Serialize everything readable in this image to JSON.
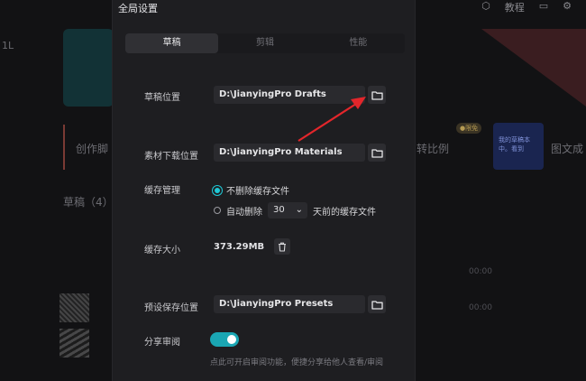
{
  "background": {
    "sidebar_glyph": "1L",
    "create_label": "创作脚",
    "ratio_label": "转比例",
    "badge": "●限免",
    "promo_text": "我的草稿本中。看到",
    "doc_label": "图文成",
    "drafts_header": "草稿（4）",
    "time1": "00:00",
    "time2": "00:00",
    "icons": [
      "shield-icon",
      "help-icon",
      "message-icon",
      "settings-icon"
    ],
    "top_label": "教程"
  },
  "dialog": {
    "title": "全局设置",
    "tabs": [
      {
        "label": "草稿",
        "active": true
      },
      {
        "label": "剪辑",
        "active": false
      },
      {
        "label": "性能",
        "active": false
      }
    ],
    "draft_location": {
      "label": "草稿位置",
      "value": "D:\\JianyingPro Drafts"
    },
    "material_location": {
      "label": "素材下载位置",
      "value": "D:\\JianyingPro Materials"
    },
    "cache": {
      "label": "缓存管理",
      "option1": "不删除缓存文件",
      "option2_prefix": "自动删除",
      "option2_days": "30",
      "option2_suffix": "天前的缓存文件"
    },
    "cache_size": {
      "label": "缓存大小",
      "value": "373.29MB"
    },
    "preset_location": {
      "label": "预设保存位置",
      "value": "D:\\JianyingPro Presets"
    },
    "share_review": {
      "label": "分享审阅",
      "enabled": true
    },
    "hint": "点此可开启审阅功能，便捷分享给他人查看/审阅"
  },
  "colors": {
    "accent": "#1ec8d6",
    "arrow": "#e3262b"
  }
}
